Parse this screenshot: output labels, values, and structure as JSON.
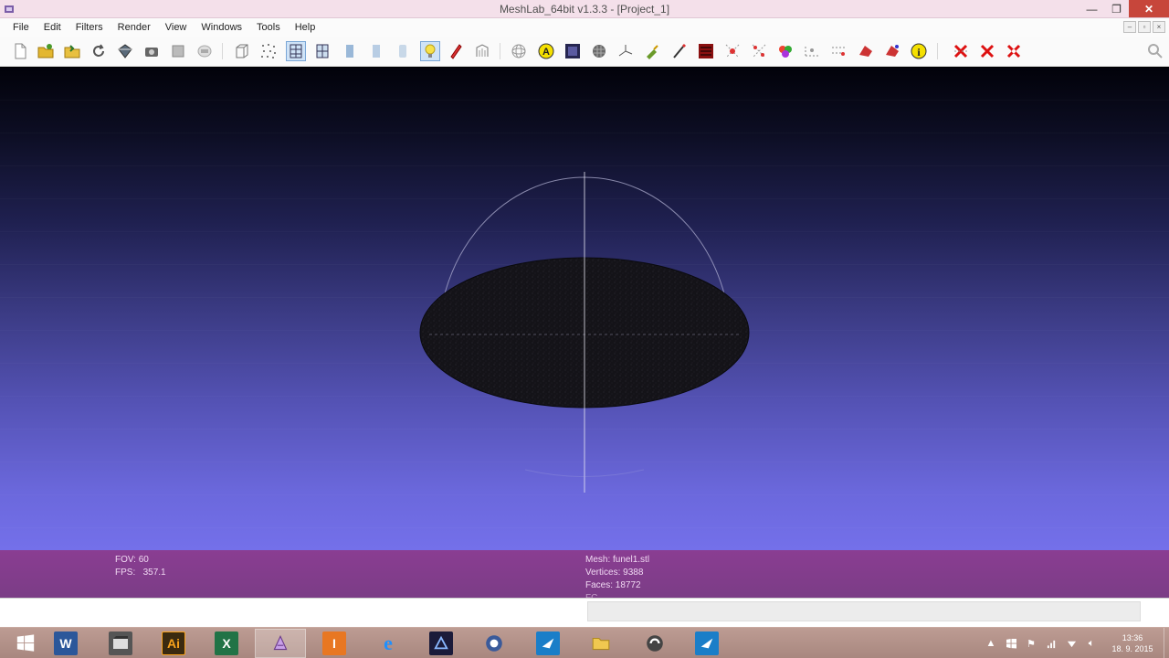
{
  "window": {
    "title": "MeshLab_64bit v1.3.3 - [Project_1]",
    "minimize": "—",
    "maximize": "❐",
    "close": "✕"
  },
  "menu": {
    "items": [
      "File",
      "Edit",
      "Filters",
      "Render",
      "View",
      "Windows",
      "Tools",
      "Help"
    ]
  },
  "toolbar": {
    "buttons": [
      {
        "name": "new-project-icon"
      },
      {
        "name": "open-project-icon"
      },
      {
        "name": "import-mesh-icon"
      },
      {
        "name": "reload-icon"
      },
      {
        "name": "export-mesh-icon"
      },
      {
        "name": "snapshot-icon"
      },
      {
        "name": "bounding-box-icon"
      },
      {
        "name": "points-icon"
      },
      {
        "name": "wireframe-icon"
      },
      {
        "name": "hidden-lines-icon"
      },
      {
        "name": "flat-lines-icon"
      },
      {
        "name": "flat-icon"
      },
      {
        "name": "smooth-icon"
      },
      {
        "name": "light-on-off-icon"
      },
      {
        "name": "double-side-light-icon"
      },
      {
        "name": "fancy-lighting-icon"
      },
      {
        "name": "trackball-icon"
      },
      {
        "name": "annotation-icon"
      },
      {
        "name": "show-layers-icon"
      },
      {
        "name": "texture-icon"
      },
      {
        "name": "axis-icon"
      },
      {
        "name": "paint-icon"
      },
      {
        "name": "brush-icon"
      },
      {
        "name": "select-faces-icon"
      },
      {
        "name": "select-vertices-icon"
      },
      {
        "name": "select-connected-icon"
      },
      {
        "name": "color-mesh-icon"
      },
      {
        "name": "measure-icon"
      },
      {
        "name": "align-icon"
      },
      {
        "name": "manipulator-icon"
      },
      {
        "name": "pick-points-icon"
      },
      {
        "name": "info-icon"
      },
      {
        "name": "delete-faces-icon"
      },
      {
        "name": "delete-vertices-icon"
      },
      {
        "name": "delete-selection-icon"
      }
    ],
    "search_icon": "magnifier-icon"
  },
  "info": {
    "fov_label": "FOV: 60",
    "fps_label": "FPS:",
    "fps_value": "357.1",
    "mesh_label": "Mesh: funel1.stl",
    "vertices_label": "Vertices: 9388",
    "faces_label": "Faces: 18772",
    "fc_label": "FC"
  },
  "taskbar": {
    "apps": [
      {
        "name": "start-button",
        "label": ""
      },
      {
        "name": "word-icon",
        "label": "W"
      },
      {
        "name": "movie-maker-icon",
        "label": ""
      },
      {
        "name": "illustrator-icon",
        "label": "Ai"
      },
      {
        "name": "excel-icon",
        "label": "X"
      },
      {
        "name": "meshlab-icon",
        "label": ""
      },
      {
        "name": "inventor-icon",
        "label": "I"
      },
      {
        "name": "internet-explorer-icon",
        "label": "e"
      },
      {
        "name": "photoshop-icon",
        "label": ""
      },
      {
        "name": "settings-app-icon",
        "label": ""
      },
      {
        "name": "sketch-app-icon",
        "label": ""
      },
      {
        "name": "file-explorer-icon",
        "label": ""
      },
      {
        "name": "media-app-icon",
        "label": ""
      },
      {
        "name": "sketch-app-2-icon",
        "label": ""
      }
    ],
    "clock_time": "13:36",
    "clock_date": "18. 9. 2015"
  },
  "colors": {
    "titlebar": "#f4e0ea",
    "infobar": "#8a3d92",
    "viewport_top": "#02020a",
    "viewport_bottom": "#7470ea",
    "mesh": "#151418",
    "taskbar": "#b09088"
  }
}
